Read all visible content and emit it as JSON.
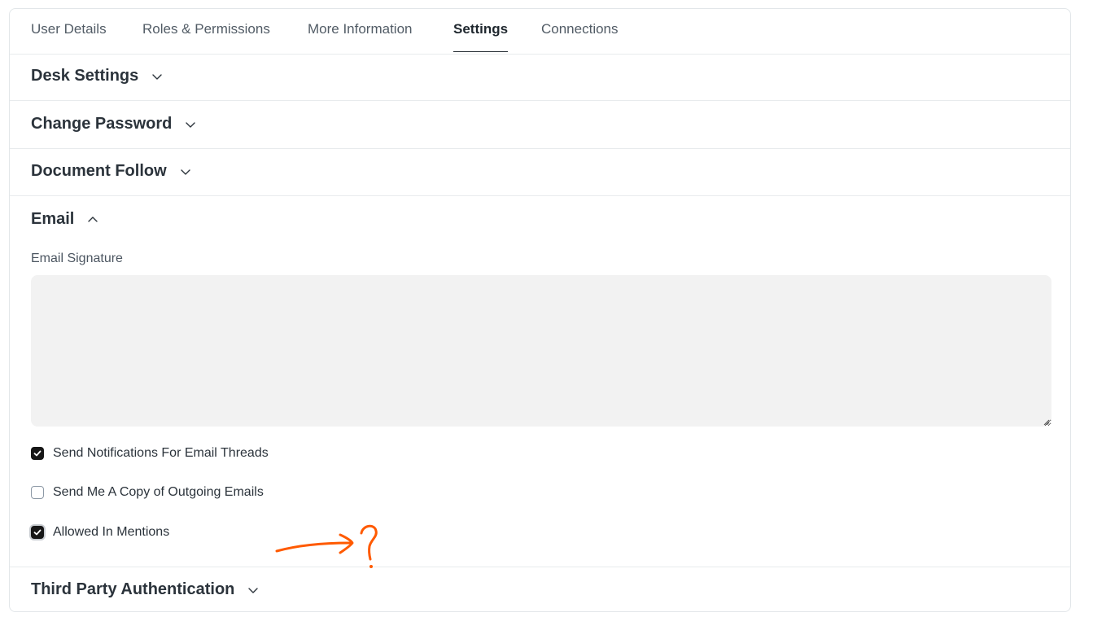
{
  "tabs": [
    {
      "label": "User Details",
      "active": false
    },
    {
      "label": "Roles & Permissions",
      "active": false
    },
    {
      "label": "More Information",
      "active": false
    },
    {
      "label": "Settings",
      "active": true
    },
    {
      "label": "Connections",
      "active": false
    }
  ],
  "sections": {
    "desk_settings": {
      "title": "Desk Settings",
      "expanded": false,
      "icon": "chevron-down-icon"
    },
    "change_password": {
      "title": "Change Password",
      "expanded": false,
      "icon": "chevron-down-icon"
    },
    "document_follow": {
      "title": "Document Follow",
      "expanded": false,
      "icon": "chevron-down-icon"
    },
    "email": {
      "title": "Email",
      "expanded": true,
      "icon": "chevron-up-icon",
      "signature_label": "Email Signature",
      "signature_value": "",
      "checkboxes": [
        {
          "label": "Send Notifications For Email Threads",
          "checked": true
        },
        {
          "label": "Send Me A Copy of Outgoing Emails",
          "checked": false
        },
        {
          "label": "Allowed In Mentions",
          "checked": true
        }
      ]
    },
    "third_party_auth": {
      "title": "Third Party Authentication",
      "expanded": false,
      "icon": "chevron-down-icon"
    }
  },
  "annotation": {
    "symbol": "?",
    "color": "#ff5a00"
  },
  "colors": {
    "checkbox_checked": "#171717",
    "text": "#1f272e",
    "muted": "#525c66"
  }
}
